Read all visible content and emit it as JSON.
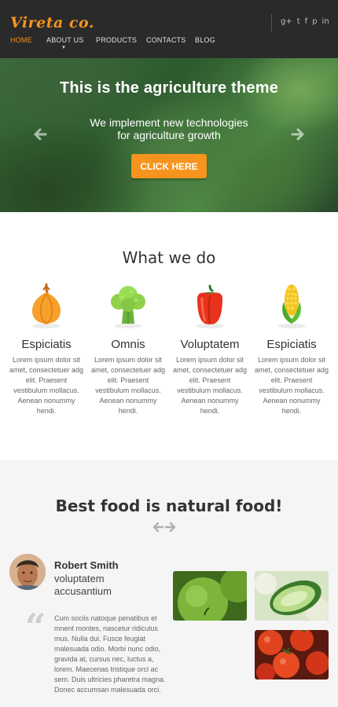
{
  "header": {
    "logo": "Vireta co.",
    "social_icons": [
      "google-plus-icon",
      "twitter-icon",
      "facebook-icon",
      "pinterest-icon",
      "linkedin-icon"
    ],
    "social_glyphs": [
      "g+",
      "t",
      "f",
      "p",
      "in"
    ],
    "nav": [
      {
        "label": "HOME",
        "active": true
      },
      {
        "label": "ABOUT US"
      },
      {
        "label": "PRODUCTS"
      },
      {
        "label": "CONTACTS"
      },
      {
        "label": "BLOG"
      }
    ]
  },
  "hero": {
    "title": "This is the agriculture theme",
    "subtitle_line1": "We implement new technologies",
    "subtitle_line2": "for agriculture growth",
    "button": "CLICK HERE"
  },
  "what_we_do": {
    "title": "What we do",
    "items": [
      {
        "title": "Espiciatis",
        "icon": "onion-icon",
        "text": "Lorem ipsum dolor sit amet, consectetuer adg elit. Praesent vestibulum mollacus. Aenean nonummy hendi."
      },
      {
        "title": "Omnis",
        "icon": "broccoli-icon",
        "text": "Lorem ipsum dolor sit amet, consectetuer adg elit. Praesent vestibulum mollacus. Aenean nonummy hendi."
      },
      {
        "title": "Voluptatem",
        "icon": "pepper-icon",
        "text": "Lorem ipsum dolor sit amet, consectetuer adg elit. Praesent vestibulum mollacus. Aenean nonummy hendi."
      },
      {
        "title": "Espiciatis",
        "icon": "corn-icon",
        "text": "Lorem ipsum dolor sit amet, consectetuer adg elit. Praesent vestibulum mollacus. Aenean nonummy hendi."
      }
    ]
  },
  "best_food": {
    "title": "Best food is natural food!",
    "person_name": "Robert Smith",
    "person_role": "voluptatem accusantium",
    "quote": "Cum sociis natoque penatibus et mnent montes, nascetur ridiculus mus. Nulla dui. Fusce feugiat malesuada odio. Morbi nunc odio, gravida at, cursus nec, luctus a, lorem. Maecenas tristique orci ac sem. Duis ultricies pharetra magna. Donec accumsan malesuada orci."
  },
  "colors": {
    "accent": "#f7941d",
    "header_bg": "#2a2a2a",
    "section_gray": "#f5f5f5"
  }
}
